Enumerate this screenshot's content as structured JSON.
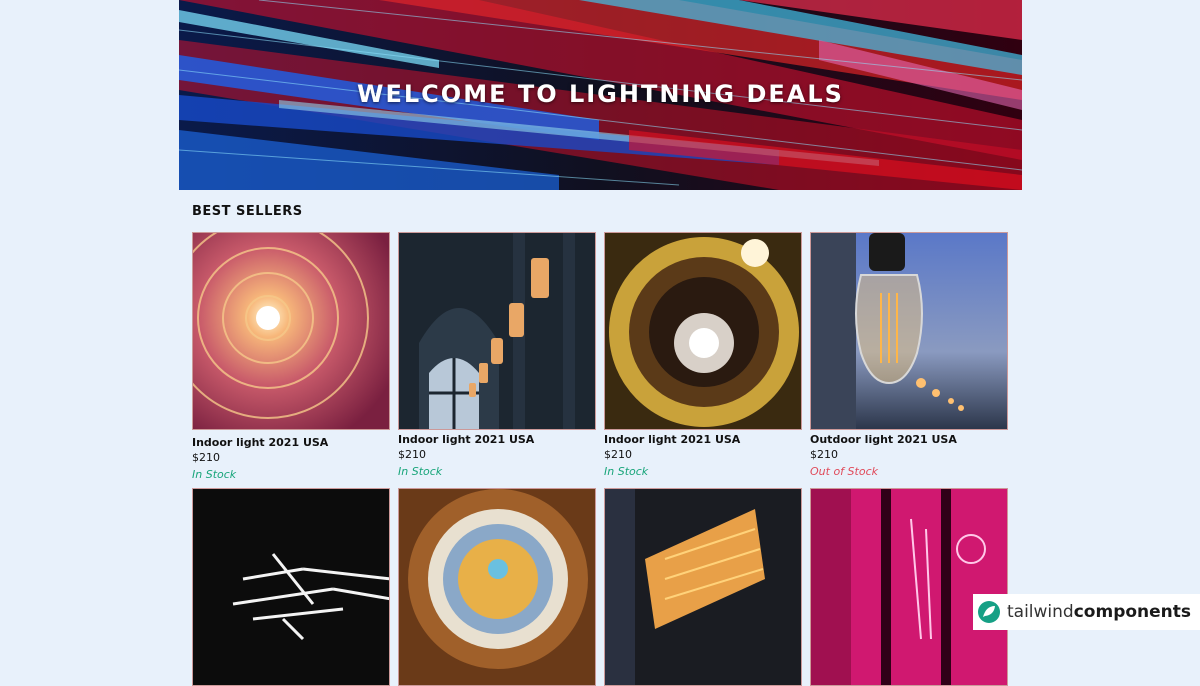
{
  "hero": {
    "title": "WELCOME TO LIGHTNING DEALS"
  },
  "section": {
    "title": "BEST SELLERS"
  },
  "products": [
    {
      "name": "Indoor light 2021 USA",
      "price": "$210",
      "stock": "In Stock",
      "in_stock": true
    },
    {
      "name": "Indoor light 2021 USA",
      "price": "$210",
      "stock": "In Stock",
      "in_stock": true
    },
    {
      "name": "Indoor light 2021 USA",
      "price": "$210",
      "stock": "In Stock",
      "in_stock": true
    },
    {
      "name": "Outdoor light 2021 USA",
      "price": "$210",
      "stock": "Out of Stock",
      "in_stock": false
    }
  ],
  "watermark": {
    "part1": "tailwind",
    "part2": "components"
  },
  "colors": {
    "in_stock": "#18a57a",
    "out_of_stock": "#e04a5a",
    "page_bg": "#e8f1fb"
  }
}
